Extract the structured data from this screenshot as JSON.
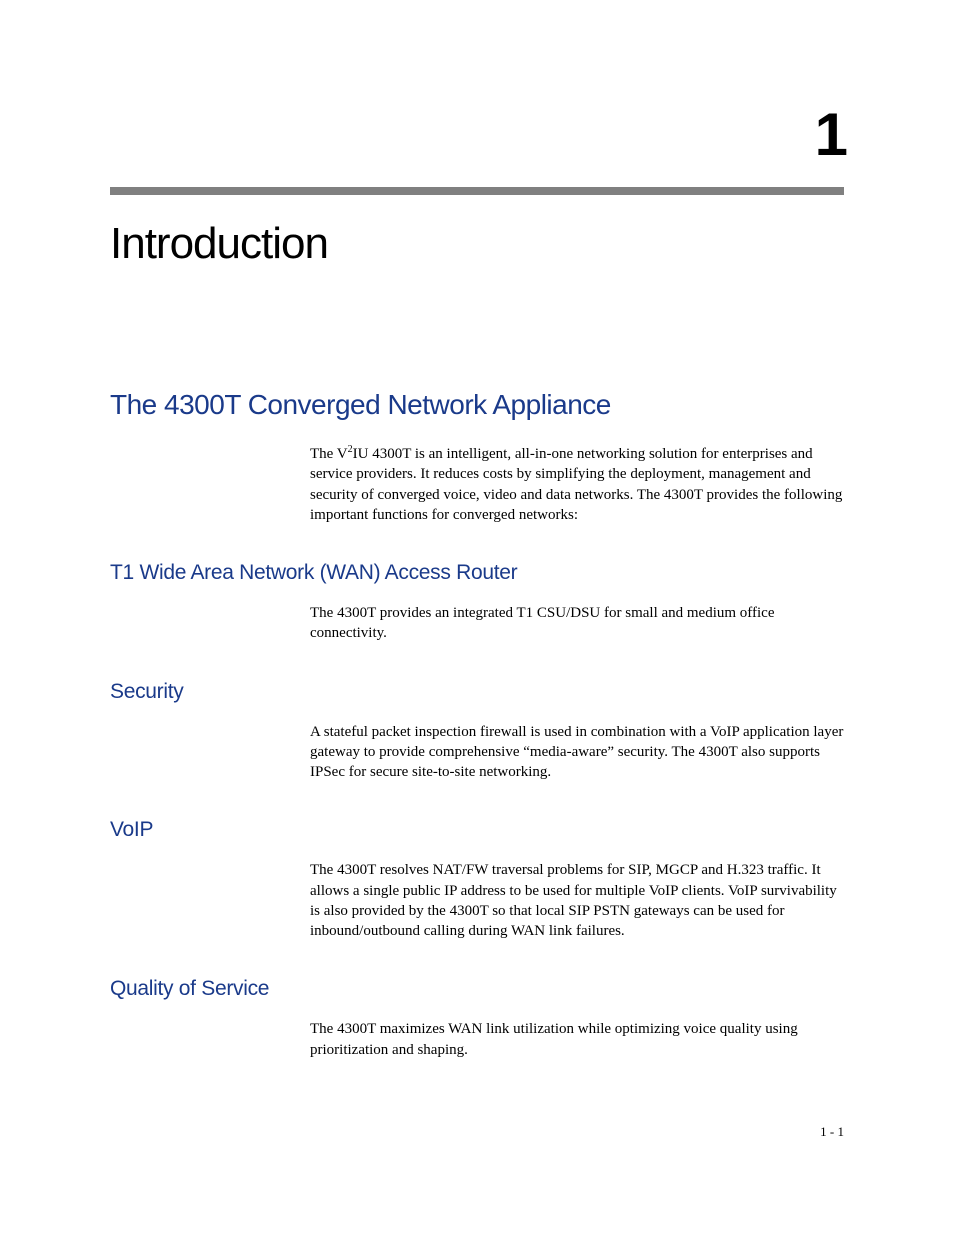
{
  "chapter": {
    "number": "1",
    "title": "Introduction"
  },
  "section": {
    "heading": "The 4300T Converged Network Appliance",
    "intro_prefix": "The V",
    "intro_sup": "2",
    "intro_rest": "IU 4300T is an intelligent, all-in-one networking solution for enterprises and service providers.  It reduces costs by simplifying the deployment, management and security of converged voice, video and data networks.  The 4300T provides the following important functions for converged networks:"
  },
  "subsections": [
    {
      "heading": "T1 Wide Area Network (WAN) Access Router",
      "body": "The 4300T provides an integrated T1 CSU/DSU for small and medium office connectivity."
    },
    {
      "heading": "Security",
      "body": "A stateful packet inspection firewall is used in combination with a VoIP application layer gateway to provide comprehensive “media-aware” security.  The 4300T also supports IPSec for secure site-to-site networking."
    },
    {
      "heading": "VoIP",
      "body": "The 4300T resolves NAT/FW traversal problems for SIP, MGCP and H.323 traffic.  It allows a single public IP address to be used for multiple VoIP clients.  VoIP survivability is also provided by the 4300T so that local SIP PSTN gateways can be used for inbound/outbound calling during WAN link failures."
    },
    {
      "heading": "Quality of Service",
      "body": "The 4300T maximizes WAN link utilization while optimizing voice quality using prioritization and shaping."
    }
  ],
  "page_number": "1 - 1"
}
